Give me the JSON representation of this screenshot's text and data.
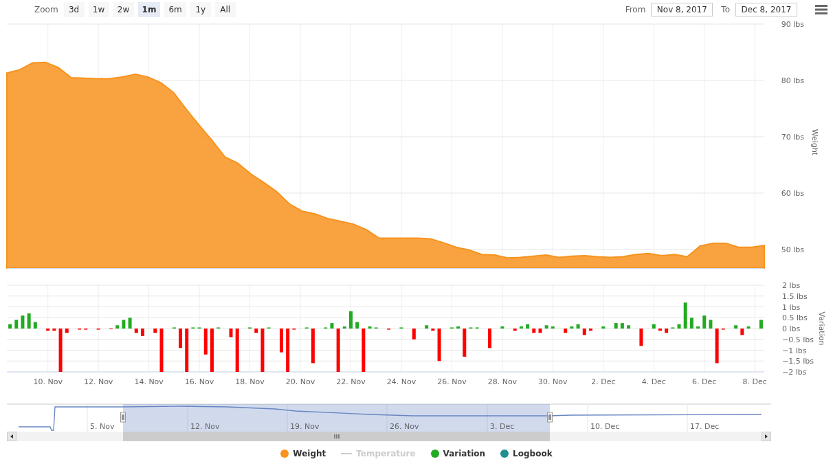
{
  "range_selector": {
    "zoom_label": "Zoom",
    "buttons": [
      {
        "label": "3d",
        "selected": false
      },
      {
        "label": "1w",
        "selected": false
      },
      {
        "label": "2w",
        "selected": false
      },
      {
        "label": "1m",
        "selected": true
      },
      {
        "label": "6m",
        "selected": false
      },
      {
        "label": "1y",
        "selected": false
      },
      {
        "label": "All",
        "selected": false
      }
    ]
  },
  "date_range": {
    "from_label": "From",
    "from_value": "Nov 8, 2017",
    "to_label": "To",
    "to_value": "Dec 8, 2017"
  },
  "weight_chart": {
    "chart_data": {
      "type": "area",
      "ylabel": "Weight",
      "ylim": [
        46.7,
        90
      ],
      "grid": true,
      "yticks": [
        {
          "value": 90,
          "label": "90 lbs"
        },
        {
          "value": 80,
          "label": "80 lbs"
        },
        {
          "value": 70,
          "label": "70 lbs"
        },
        {
          "value": 60,
          "label": "60 lbs"
        },
        {
          "value": 50,
          "label": "50 lbs"
        }
      ],
      "categories": [
        null,
        null,
        null,
        null,
        null,
        null,
        null,
        null,
        null,
        null,
        null,
        null,
        null,
        null,
        null,
        null,
        null,
        null,
        null,
        null,
        null,
        null,
        null,
        null,
        null,
        null,
        null,
        null,
        null,
        null,
        null,
        null,
        null,
        null,
        null,
        null,
        null,
        null,
        null,
        null,
        null,
        null,
        null,
        null,
        null,
        null,
        null,
        null,
        null,
        null,
        null,
        null,
        null,
        null,
        null,
        null,
        null,
        null,
        null,
        null
      ],
      "series": [
        {
          "color": "#f7931e",
          "values": [
            81.3,
            81.9,
            83.1,
            83.2,
            82.3,
            80.5,
            80.4,
            80.3,
            80.3,
            80.6,
            81.1,
            80.6,
            79.6,
            77.8,
            74.8,
            72,
            69.3,
            66.4,
            65.3,
            63.4,
            61.9,
            60.3,
            58.1,
            56.8,
            56.3,
            55.5,
            55,
            54.5,
            53.5,
            52,
            52,
            52,
            52,
            51.9,
            51.2,
            50.4,
            49.9,
            49.1,
            49,
            48.5,
            48.6,
            48.8,
            49,
            48.6,
            48.8,
            48.9,
            48.7,
            48.6,
            48.7,
            49.1,
            49.3,
            48.9,
            49.1,
            48.7,
            50.6,
            51.1,
            51.1,
            50.4,
            50.4,
            50.7
          ]
        }
      ]
    }
  },
  "variation_chart": {
    "chart_data": {
      "type": "bar",
      "ylabel": "Variation",
      "ylim": [
        -2,
        2
      ],
      "grid": true,
      "yticks": [
        {
          "value": 2,
          "label": "2 lbs"
        },
        {
          "value": 1.5,
          "label": "1.5 lbs"
        },
        {
          "value": 1,
          "label": "1 lbs"
        },
        {
          "value": 0.5,
          "label": "0.5 lbs"
        },
        {
          "value": 0,
          "label": "0 lbs"
        },
        {
          "value": -0.5,
          "label": "−0.5 lbs"
        },
        {
          "value": -1,
          "label": "−1 lbs"
        },
        {
          "value": -1.5,
          "label": "−1.5 lbs"
        },
        {
          "value": -2,
          "label": "−2 lbs"
        }
      ],
      "categories": [
        null,
        null,
        null,
        null,
        null,
        null,
        "10. Nov",
        null,
        null,
        null,
        null,
        null,
        null,
        null,
        "12. Nov",
        null,
        null,
        null,
        null,
        null,
        null,
        null,
        "14. Nov",
        null,
        null,
        null,
        null,
        null,
        null,
        null,
        "16. Nov",
        null,
        null,
        null,
        null,
        null,
        null,
        null,
        "18. Nov",
        null,
        null,
        null,
        null,
        null,
        null,
        null,
        "20. Nov",
        null,
        null,
        null,
        null,
        null,
        null,
        null,
        "22. Nov",
        null,
        null,
        null,
        null,
        null,
        null,
        null,
        "24. Nov",
        null,
        null,
        null,
        null,
        null,
        null,
        null,
        "26. Nov",
        null,
        null,
        null,
        null,
        null,
        null,
        null,
        "28. Nov",
        null,
        null,
        null,
        null,
        null,
        null,
        null,
        "30. Nov",
        null,
        null,
        null,
        null,
        null,
        null,
        null,
        "2. Dec",
        null,
        null,
        null,
        null,
        null,
        null,
        null,
        "4. Dec",
        null,
        null,
        null,
        null,
        null,
        null,
        null,
        "6. Dec",
        null,
        null,
        null,
        null,
        null,
        null,
        null,
        "8. Dec",
        null
      ],
      "series": [
        {
          "color": "#22aa22",
          "values": [
            0.2,
            0.4,
            0.6,
            0.7,
            0.3,
            null,
            null,
            null,
            null,
            null,
            null,
            null,
            null,
            null,
            null,
            null,
            null,
            0.15,
            0.4,
            0.5,
            null,
            null,
            null,
            null,
            null,
            null,
            0.05,
            null,
            null,
            0.05,
            0.05,
            null,
            null,
            0.05,
            null,
            null,
            null,
            null,
            0.05,
            null,
            null,
            0.05,
            null,
            null,
            null,
            null,
            null,
            0.05,
            null,
            null,
            0.05,
            0.25,
            null,
            0.1,
            0.8,
            0.3,
            null,
            0.1,
            0.05,
            null,
            null,
            null,
            0.05,
            null,
            null,
            null,
            0.15,
            null,
            null,
            null,
            0.05,
            0.1,
            null,
            0.05,
            0.05,
            null,
            null,
            null,
            0.1,
            null,
            null,
            0.1,
            0.2,
            null,
            null,
            0.15,
            0.1,
            null,
            null,
            0.1,
            0.2,
            null,
            null,
            null,
            0.1,
            null,
            0.25,
            0.25,
            0.15,
            null,
            null,
            null,
            0.2,
            null,
            null,
            0.05,
            0.2,
            1.2,
            0.5,
            0.1,
            0.6,
            0.4,
            null,
            null,
            null,
            0.15,
            null,
            0.1,
            null,
            0.4
          ]
        },
        {
          "color": "#ff0000",
          "values": [
            null,
            null,
            null,
            null,
            null,
            null,
            -0.1,
            -0.1,
            -2,
            -0.2,
            null,
            -0.05,
            -0.05,
            null,
            -0.05,
            null,
            -0.03,
            null,
            null,
            null,
            -0.2,
            -0.35,
            null,
            -0.2,
            -2,
            null,
            null,
            -0.9,
            -2,
            null,
            null,
            -1.2,
            -2,
            null,
            null,
            -0.4,
            -2,
            null,
            null,
            -0.2,
            -2,
            null,
            null,
            -1.1,
            -2,
            -0.05,
            null,
            null,
            -1.6,
            null,
            null,
            null,
            -2,
            null,
            null,
            null,
            -2,
            null,
            null,
            null,
            -0.05,
            null,
            null,
            null,
            -0.5,
            null,
            null,
            -0.1,
            -1.5,
            null,
            null,
            null,
            -1.3,
            null,
            null,
            null,
            -0.9,
            null,
            null,
            null,
            -0.1,
            null,
            null,
            -0.2,
            -0.2,
            null,
            null,
            null,
            -0.2,
            null,
            null,
            -0.3,
            -0.1,
            null,
            null,
            null,
            null,
            null,
            null,
            null,
            -0.8,
            null,
            null,
            -0.1,
            -0.2,
            null,
            null,
            null,
            null,
            null,
            null,
            null,
            -1.6,
            -0.05,
            null,
            null,
            -0.3,
            null,
            null,
            null
          ]
        }
      ]
    }
  },
  "navigator": {
    "labels": [
      "5. Nov",
      "12. Nov",
      "19. Nov",
      "26. Nov",
      "3. Dec",
      "10. Dec",
      "17. Dec"
    ]
  },
  "legend": [
    {
      "label": "Weight",
      "kind": "dot",
      "color": "#f7931e",
      "visible": true
    },
    {
      "label": "Temperature",
      "kind": "line",
      "visible": false
    },
    {
      "label": "Variation",
      "kind": "dot",
      "color": "#22aa22",
      "visible": true
    },
    {
      "label": "Logbook",
      "kind": "dot",
      "color": "#1f9090",
      "visible": true
    }
  ]
}
